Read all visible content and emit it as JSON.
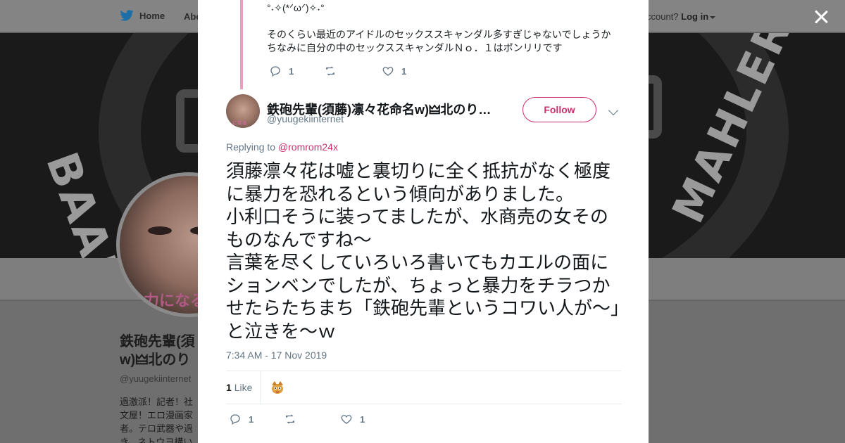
{
  "nav": {
    "home_label": "Home",
    "about_label_partial": "Abo",
    "account_prompt_partial": "ccount?",
    "login_label": "Log in"
  },
  "banner": {
    "left_word": "BAADE",
    "right_word": "MAHLER"
  },
  "profile": {
    "name": "鉄砲先輩(須藤)凛々花命名w)🜲北のり…",
    "name_visible_partial": "鉄砲先輩(須\nw)🜲北のり",
    "handle": "@yuugekiinternet",
    "avatar_caption": "力になる",
    "bio_partial": "過激派！記者！社\n文屋！エロ漫画家\n者。テロ武器や過\nき。ネトウヨ構い"
  },
  "parent_tweet": {
    "text": "°˖✧(*ᐟωᐟ)✧˖°\n\nそのくらい最近のアイドルのセックススキャンダル多すぎじゃないでしょうか\nちなみに自分の中のセックススキャンダルＮｏ．１はポンリリです",
    "reply_count": "1",
    "like_count": "1"
  },
  "tweet": {
    "author_name": "鉄砲先輩(須藤)凛々花命名w)🜲北のり…",
    "author_handle": "@yuugekiinternet",
    "avatar_caption": "になる",
    "follow_label": "Follow",
    "replying_prefix": "Replying to",
    "replying_to": "@romrom24x",
    "text": "須藤凛々花は嘘と裏切りに全く抵抗がなく極度に暴力を恐れるという傾向がありました。\n小利口そうに装ってましたが、水商売の女そのものなんですね～\n言葉を尽くしていろいろ書いてもカエルの面にションベンでしたが、ちょっと暴力をチラつかせたらたちまち「鉄砲先輩というコワい人が～」と泣きを～ｗ",
    "timestamp": "7:34 AM - 17 Nov 2019",
    "likes_number": "1",
    "likes_label": "Like",
    "reply_count": "1",
    "retweet_count": "",
    "like_count": "1"
  },
  "colors": {
    "accent": "#cd2e6f",
    "thread_line": "#e3a2c0",
    "muted_text": "#657786"
  },
  "icons": [
    "twitter-bird-icon",
    "caret-down-icon",
    "close-icon",
    "reply-icon",
    "retweet-icon",
    "heart-icon",
    "chevron-down-icon",
    "liker-avatar-icon"
  ]
}
